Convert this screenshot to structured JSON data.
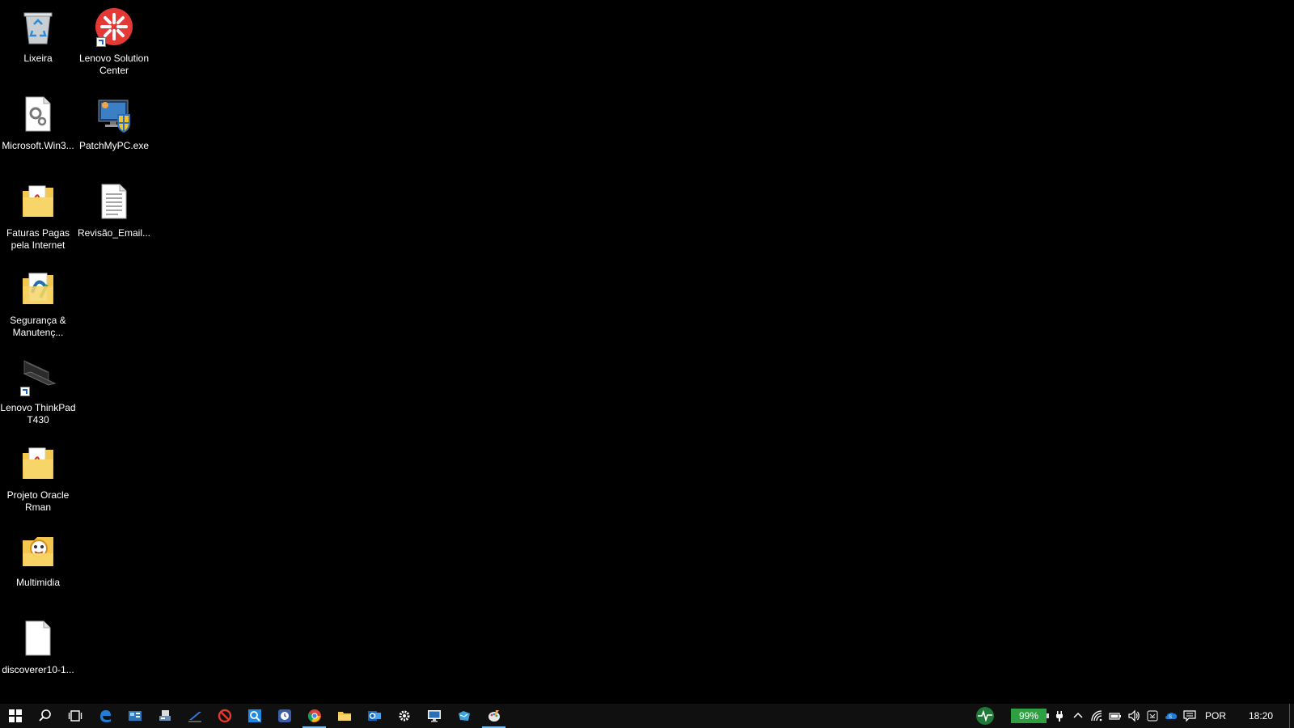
{
  "desktop": {
    "icons": [
      {
        "label": "Lixeira",
        "icon": "recycle-bin-icon"
      },
      {
        "label": "Lenovo Solution Center",
        "icon": "lenovo-solution-center-icon"
      },
      {
        "label": "Microsoft.Win3...",
        "icon": "config-file-icon"
      },
      {
        "label": "PatchMyPC.exe",
        "icon": "patchmypc-icon"
      },
      {
        "label": "Faturas Pagas pela Internet",
        "icon": "pdf-folder-icon"
      },
      {
        "label": "Revisão_Email...",
        "icon": "text-document-icon"
      },
      {
        "label": "Segurança & Manutenç...",
        "icon": "security-folder-icon"
      },
      {
        "label": "Lenovo ThinkPad T430",
        "icon": "laptop-icon"
      },
      {
        "label": "Projeto Oracle Rman",
        "icon": "pdf-folder-icon"
      },
      {
        "label": "Multimidia",
        "icon": "multimedia-folder-icon"
      },
      {
        "label": "discoverer10-1...",
        "icon": "blank-file-icon"
      }
    ]
  },
  "taskbar": {
    "pinned": [
      {
        "name": "start",
        "icon": "windows-logo-icon"
      },
      {
        "name": "search",
        "icon": "search-icon"
      },
      {
        "name": "task-view",
        "icon": "task-view-icon"
      },
      {
        "name": "edge",
        "icon": "edge-icon"
      },
      {
        "name": "control-panel",
        "icon": "control-panel-icon"
      },
      {
        "name": "scanner",
        "icon": "scanner-icon"
      },
      {
        "name": "sign-app",
        "icon": "signature-icon"
      },
      {
        "name": "blocker",
        "icon": "no-entry-icon"
      },
      {
        "name": "search-app",
        "icon": "magnifier-app-icon"
      },
      {
        "name": "clock-app",
        "icon": "clock-app-icon"
      },
      {
        "name": "chrome",
        "icon": "chrome-icon",
        "active": true
      },
      {
        "name": "file-explorer",
        "icon": "folder-icon"
      },
      {
        "name": "outlook",
        "icon": "outlook-icon"
      },
      {
        "name": "settings",
        "icon": "gear-icon"
      },
      {
        "name": "remote-desktop",
        "icon": "monitor-icon"
      },
      {
        "name": "network-app",
        "icon": "network-map-icon"
      },
      {
        "name": "paint-app",
        "icon": "paint-icon",
        "active": true
      }
    ],
    "tray": {
      "battery_percent": "99%",
      "language": "POR",
      "time": "18:20"
    }
  },
  "colors": {
    "desktop_bg": "#000000",
    "taskbar_bg": "#101010",
    "battery_green": "#2ea043",
    "active_indicator": "#76b9ed"
  }
}
